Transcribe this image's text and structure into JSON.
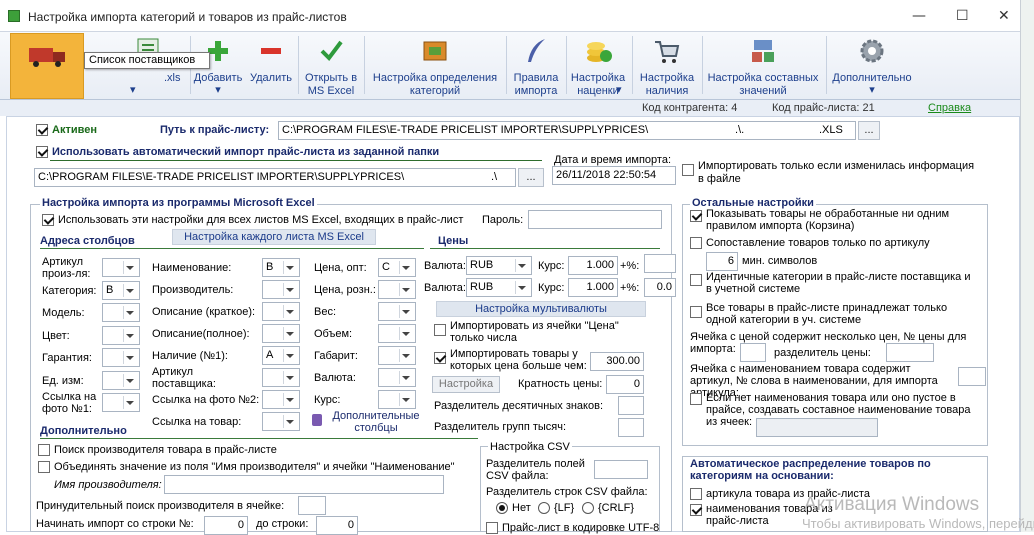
{
  "window": {
    "title": "Настройка импорта категорий и товаров из прайс-листов",
    "minimize": "—",
    "maximize": "☐",
    "close": "✕"
  },
  "toolbar": {
    "first_suffix": ".xls",
    "tooltip": "Список поставщиков",
    "items": [
      {
        "label": "Добавить",
        "arrow": "▾",
        "icon": "add-icon"
      },
      {
        "label": "Удалить",
        "icon": "delete-icon"
      },
      {
        "label": "Открыть в MS Excel",
        "icon": "checkmark-icon"
      },
      {
        "label": "Настройка определения категорий",
        "icon": "category-icon"
      },
      {
        "label": "Правила импорта",
        "icon": "quill-icon"
      },
      {
        "label": "Настройка наценки",
        "arrow": "▾",
        "icon": "coins-icon"
      },
      {
        "label": "Настройка наличия",
        "icon": "cart-icon"
      },
      {
        "label": "Настройка составных значений",
        "icon": "components-icon"
      },
      {
        "label": "Дополнительно",
        "arrow": "▾",
        "icon": "gear-icon"
      }
    ]
  },
  "infobar": {
    "contractor_code": "Код контрагента: 4",
    "pricelist_code": "Код прайс-листа: 21",
    "help": "Справка"
  },
  "top": {
    "active": "Активен",
    "path_label": "Путь к прайс-листу:",
    "path_value": "C:\\PROGRAM FILES\\E-TRADE PRICELIST IMPORTER\\SUPPLYPRICES\\",
    "path_suffix": ".\\.",
    "path_ext": ".XLS",
    "browse": "...",
    "auto_import": "Использовать автоматический импорт прайс-листа из заданной папки",
    "folder_value": "C:\\PROGRAM FILES\\E-TRADE PRICELIST IMPORTER\\SUPPLYPRICES\\",
    "folder_suffix": ".\\",
    "datetime_label": "Дата и время импорта:",
    "datetime_value": "26/11/2018 22:50:54",
    "only_changed": "Импортировать только если изменилась информация в файле"
  },
  "excel": {
    "title": "Настройка импорта из программы Microsoft Excel",
    "use_all": "Использовать эти настройки для всех листов MS Excel, входящих в прайс-лист",
    "password_label": "Пароль:",
    "columns_title": "Адреса столбцов",
    "per_sheet": "Настройка каждого листа MS Excel",
    "col1": [
      {
        "label": "Артикул произ-ля:",
        "value": ""
      },
      {
        "label": "Категория:",
        "value": "B"
      },
      {
        "label": "Модель:",
        "value": ""
      },
      {
        "label": "Цвет:",
        "value": ""
      },
      {
        "label": "Гарантия:",
        "value": ""
      },
      {
        "label": "Ед. изм:",
        "value": ""
      },
      {
        "label": "Ссылка на фото №1:",
        "value": ""
      }
    ],
    "col2": [
      {
        "label": "Наименование:",
        "value": "B"
      },
      {
        "label": "Производитель:",
        "value": ""
      },
      {
        "label": "Описание (краткое):",
        "value": ""
      },
      {
        "label": "Описание(полное):",
        "value": ""
      },
      {
        "label": "Наличие (№1):",
        "value": "A"
      },
      {
        "label": "Артикул поставщика:",
        "value": ""
      },
      {
        "label": "Ссылка на фото №2:",
        "value": ""
      },
      {
        "label": "Ссылка на товар:",
        "value": ""
      }
    ],
    "col3": [
      {
        "label": "Цена, опт:",
        "value": "C"
      },
      {
        "label": "Цена, розн.:",
        "value": ""
      },
      {
        "label": "Вес:",
        "value": ""
      },
      {
        "label": "Объем:",
        "value": ""
      },
      {
        "label": "Габарит:",
        "value": ""
      },
      {
        "label": "Валюта:",
        "value": ""
      },
      {
        "label": "Курс:",
        "value": ""
      }
    ],
    "extra_columns": "Дополнительные столбцы"
  },
  "prices": {
    "title": "Цены",
    "currency_label": "Валюта:",
    "rows": [
      {
        "currency": "RUB",
        "rate_label": "Курс:",
        "rate": "1.000",
        "pct_label": "+%:",
        "pct": ""
      },
      {
        "currency": "RUB",
        "rate_label": "Курс:",
        "rate": "1.000",
        "pct_label": "+%:",
        "pct": "0.0"
      }
    ],
    "multicurrency": "Настройка мультивалюты",
    "import_from_cell": "Импортировать из ячейки \"Цена\" только числа",
    "import_above": "Импортировать товары у которых цена больше чем:",
    "import_above_value": "300.00",
    "settings_btn": "Настройка",
    "price_multiplicity": "Кратность цены:",
    "price_multiplicity_value": "0",
    "decimal_sep": "Разделитель десятичных знаков:",
    "thousand_sep": "Разделитель групп тысяч:"
  },
  "additional": {
    "title": "Дополнительно",
    "search_manufacturer": "Поиск производителя товара в прайс-листе",
    "merge_manufacturer": "Объединять значение из поля \"Имя производителя\" и ячейки \"Наименование\"",
    "manufacturer_name": "Имя производителя:",
    "forced_search": "Принудительный поиск производителя в ячейке:",
    "start_row": "Начинать импорт со строки №:",
    "start_row_value": "0",
    "to_row": "до строки:",
    "to_row_value": "0"
  },
  "csv": {
    "title": "Настройка CSV",
    "field_sep": "Разделитель полей CSV файла:",
    "row_sep": "Разделитель строк CSV файла:",
    "options": [
      "Нет",
      "{LF}",
      "{CRLF}"
    ],
    "utf8": "Прайс-лист в кодировке UTF-8"
  },
  "other": {
    "title": "Остальные настройки",
    "show_unprocessed": "Показывать товары не обработанные ни одним правилом импорта (Корзина)",
    "match_by_article": "Сопоставление товаров только по артикулу",
    "min_symbols_value": "6",
    "min_symbols": "мин. символов",
    "identical_categories": "Идентичные категории в прайс-листе поставщика и в учетной системе",
    "all_one_category": "Все товары в прайс-листе принадлежат только одной категории в уч. системе",
    "cell_several_prices": "Ячейка с ценой содержит несколько цен, № цены для импорта:",
    "price_sep": "разделитель цены:",
    "cell_several_words": "Ячейка с наименованием товара содержит артикул, № слова в наименовании, для импорта артикула:",
    "composite_name": "Если нет наименования товара или оно пустое в прайсе, создавать составное наименование товара из ячеек:"
  },
  "auto_dist": {
    "title": "Автоматическое распределение товаров по категориям на основании:",
    "by_article": "артикула товара из прайс-листа",
    "by_name": "наименования товара из прайс-листа"
  },
  "watermark": {
    "line1": "Активация Windows",
    "line2": "Чтобы активировать Windows, перейдите"
  }
}
